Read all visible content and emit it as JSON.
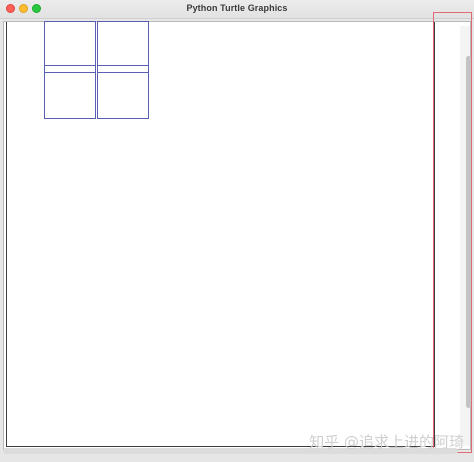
{
  "window": {
    "title": "Python Turtle Graphics",
    "controls": [
      "close",
      "minimize",
      "maximize"
    ]
  },
  "canvas": {
    "grid": {
      "rows": 2,
      "cols": 2,
      "line_color": "#5b5fb4"
    },
    "background_color": "#ffffff"
  },
  "scrollbar": {
    "orientation": "vertical",
    "highlighted": true,
    "highlight_color": "#e06a74"
  },
  "watermark": {
    "text": "知乎 @追求上进的阿琦"
  }
}
